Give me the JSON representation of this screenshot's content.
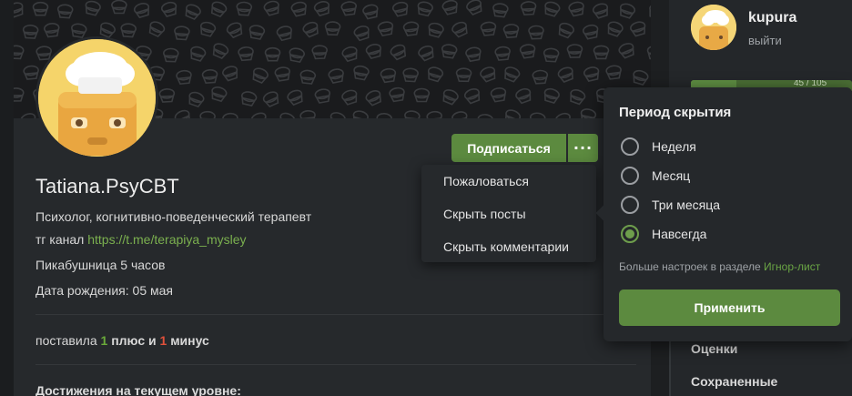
{
  "profile": {
    "name": "Tatiana.PsyCBT",
    "bio": "Психолог, когнитивно-поведенческий терапевт",
    "tg_prefix": "тг канал",
    "tg_link": "https://t.me/terapiya_mysley",
    "membership": "Пикабушница 5 часов",
    "birthday": "Дата рождения: 05 мая",
    "stats": {
      "prefix": "поставила",
      "plus_count": "1",
      "plus_word": "плюс и",
      "minus_count": "1",
      "minus_word": "минус"
    },
    "achievements_heading": "Достижения на текущем уровне:"
  },
  "actions": {
    "subscribe_label": "Подписаться",
    "more_label": "···"
  },
  "dropdown": {
    "items": [
      "Пожаловаться",
      "Скрыть посты",
      "Скрыть комментарии"
    ]
  },
  "user": {
    "name": "kupura",
    "logout": "выйти",
    "rating_partial": "45 / 105"
  },
  "sidebar": {
    "links": [
      "Оценки",
      "Сохраненные"
    ]
  },
  "hide_period": {
    "title": "Период скрытия",
    "options": [
      {
        "label": "Неделя",
        "checked": false
      },
      {
        "label": "Месяц",
        "checked": false
      },
      {
        "label": "Три месяца",
        "checked": false
      },
      {
        "label": "Навсегда",
        "checked": true
      }
    ],
    "hint_prefix": "Больше настроек в разделе",
    "hint_link": "Игнор-лист",
    "apply_label": "Применить"
  },
  "colors": {
    "accent": "#5c8a3f",
    "link": "#7bb04f",
    "plus": "#6aaa3a",
    "minus": "#e0513b",
    "background": "#1d1f21"
  },
  "icons": [
    "chef-avatar-icon",
    "more-dots-icon",
    "radio-icon"
  ]
}
